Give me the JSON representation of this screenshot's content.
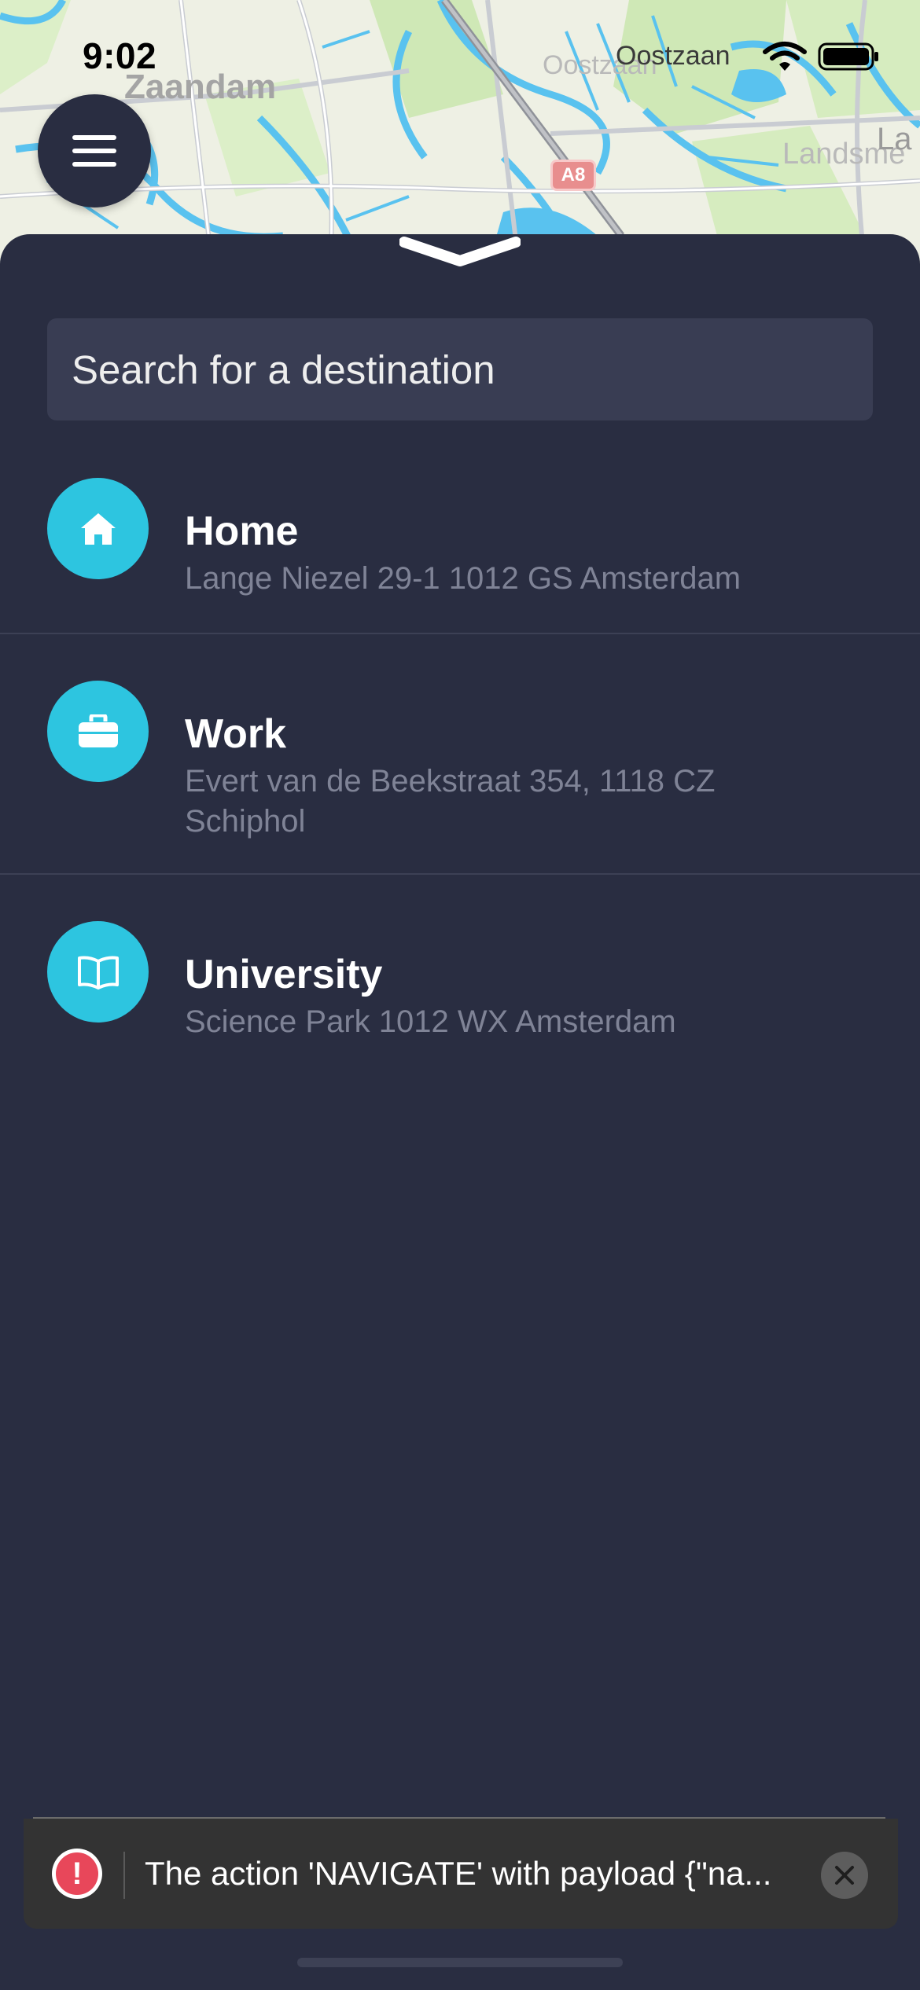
{
  "status_bar": {
    "time": "9:02",
    "carrier_label": "Oostzaan",
    "icons": [
      "wifi-icon",
      "battery-icon"
    ]
  },
  "map": {
    "labels": {
      "zaandam": "Zaandam",
      "oostzaan": "Oostzaan",
      "landsmeer": "Landsme",
      "la": "La"
    },
    "highway_shield": "A8"
  },
  "menu_button": {
    "icon": "hamburger-menu-icon"
  },
  "sheet": {
    "grabber_icon": "chevron-down-icon",
    "search": {
      "placeholder": "Search for a destination"
    },
    "destinations": [
      {
        "name": "Home",
        "address": "Lange Niezel 29-1 1012 GS Amsterdam",
        "icon": "home-icon"
      },
      {
        "name": "Work",
        "address": "Evert van de Beekstraat 354, 1118 CZ Schiphol",
        "icon": "briefcase-icon"
      },
      {
        "name": "University",
        "address": "Science Park 1012 WX Amsterdam",
        "icon": "book-icon"
      }
    ]
  },
  "toast": {
    "icon": "error-icon",
    "message": "The action 'NAVIGATE' with payload {\"na...",
    "close_icon": "close-icon"
  },
  "colors": {
    "sheet_background": "#292d41",
    "search_background": "#393d53",
    "accent": "#2dc5e0",
    "address_text": "#7f8396",
    "toast_background": "#333333",
    "error_red": "#e8475a"
  }
}
